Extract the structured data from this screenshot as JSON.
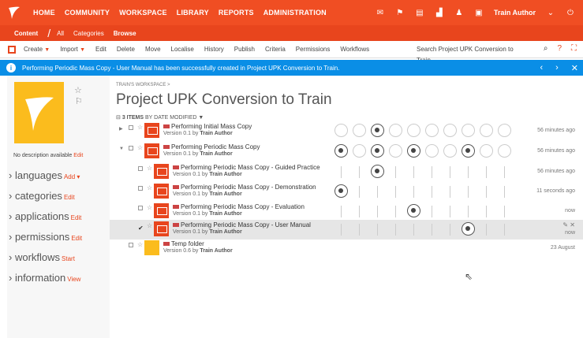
{
  "header": {
    "nav": [
      "HOME",
      "COMMUNITY",
      "WORKSPACE",
      "LIBRARY",
      "REPORTS",
      "ADMINISTRATION"
    ],
    "user": "Train Author"
  },
  "subbar": {
    "content": "Content",
    "all": "All",
    "categories": "Categories",
    "browse": "Browse"
  },
  "toolbar": {
    "create": "Create",
    "import": "Import",
    "edit": "Edit",
    "delete": "Delete",
    "move": "Move",
    "localise": "Localise",
    "history": "History",
    "publish": "Publish",
    "criteria": "Criteria",
    "permissions": "Permissions",
    "workflows": "Workflows",
    "search_placeholder": "Search Project UPK Conversion to Train"
  },
  "notice": {
    "text": "Performing Periodic Mass Copy - User Manual has been successfully created in Project UPK Conversion to Train."
  },
  "sidebar": {
    "desc": "No description available",
    "desc_edit": "Edit",
    "meta": [
      {
        "label": "languages",
        "action": "Add"
      },
      {
        "label": "categories",
        "action": "Edit"
      },
      {
        "label": "applications",
        "action": "Edit"
      },
      {
        "label": "permissions",
        "action": "Edit"
      },
      {
        "label": "workflows",
        "action": "Start"
      },
      {
        "label": "information",
        "action": "View"
      }
    ]
  },
  "main": {
    "breadcrumb": "TRAIN'S WORKSPACE >",
    "title": "Project UPK Conversion to Train",
    "count": "3 ITEMS",
    "sort": "BY DATE MODIFIED"
  },
  "items": [
    {
      "name": "Performing Initial Mass Copy",
      "version": "Version 0.1 by",
      "author": "Train Author",
      "time": "56 minutes ago"
    },
    {
      "name": "Performing Periodic Mass Copy",
      "version": "Version 0.1 by",
      "author": "Train Author",
      "time": "56 minutes ago"
    },
    {
      "name": "Performing Periodic Mass Copy - Guided Practice",
      "version": "Version 0.1 by",
      "author": "Train Author",
      "time": "56 minutes ago"
    },
    {
      "name": "Performing Periodic Mass Copy - Demonstration",
      "version": "Version 0.1 by",
      "author": "Train Author",
      "time": "11 seconds ago"
    },
    {
      "name": "Performing Periodic Mass Copy - Evaluation",
      "version": "Version 0.1 by",
      "author": "Train Author",
      "time": "now"
    },
    {
      "name": "Performing Periodic Mass Copy - User Manual",
      "version": "Version 0.1 by",
      "author": "Train Author",
      "time": "now"
    },
    {
      "name": "Temp folder",
      "version": "Version 0.6 by",
      "author": "Train Author",
      "time": "23 August"
    }
  ],
  "colors": {
    "brand": "#f04e23",
    "notice": "#0a8ee6",
    "accent": "#fbbc1d"
  }
}
